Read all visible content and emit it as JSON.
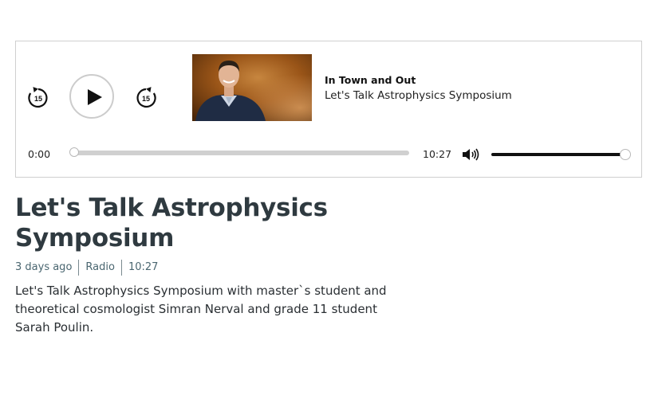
{
  "player": {
    "rewind_label": "15",
    "forward_label": "15",
    "show_name": "In Town and Out",
    "episode_name": "Let's Talk Astrophysics Symposium",
    "current_time": "0:00",
    "duration": "10:27",
    "progress_fraction": 0,
    "volume_fraction": 1,
    "icons": {
      "rewind": "rewind-15-icon",
      "play": "play-icon",
      "forward": "forward-15-icon",
      "volume": "volume-icon"
    }
  },
  "episode": {
    "title": "Let's Talk Astrophysics Symposium",
    "meta": [
      "3 days ago",
      "Radio",
      "10:27"
    ],
    "description": "Let's Talk Astrophysics Symposium with master`s student and theoretical cosmologist Simran Nerval and grade 11 student Sarah Poulin."
  },
  "colors": {
    "title": "#2f3a40",
    "meta": "#4a6670",
    "border": "#cfcfcf",
    "progress_track": "#d0d0d0",
    "volume_fill": "#111111"
  }
}
